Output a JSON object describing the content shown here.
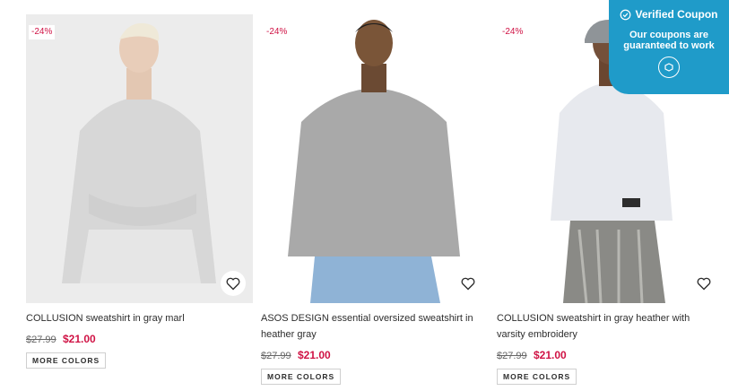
{
  "products": [
    {
      "discount": "-24%",
      "title": "COLLUSION sweatshirt in gray marl",
      "old_price": "$27.99",
      "new_price": "$21.00",
      "more_colors": "MORE COLORS"
    },
    {
      "discount": "-24%",
      "title": "ASOS DESIGN essential oversized sweatshirt in heather gray",
      "old_price": "$27.99",
      "new_price": "$21.00",
      "more_colors": "MORE COLORS"
    },
    {
      "discount": "-24%",
      "title": "COLLUSION sweatshirt in gray heather with varsity embroidery",
      "old_price": "$27.99",
      "new_price": "$21.00",
      "more_colors": "MORE COLORS"
    }
  ],
  "coupon": {
    "title": "Verified Coupon",
    "subtitle": "Our coupons are guaranteed to work"
  },
  "icons": {
    "favorite": "heart-icon",
    "verified": "check-circle-icon",
    "logo": "coupon-logo-icon"
  },
  "colors": {
    "sale": "#d01345",
    "coupon_bg": "#1f9bc9"
  }
}
